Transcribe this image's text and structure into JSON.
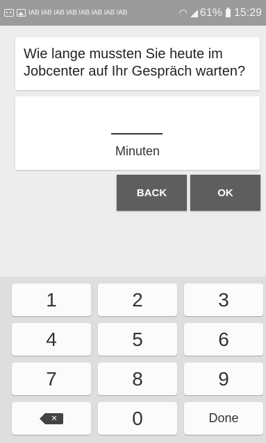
{
  "status_bar": {
    "notification_text": "IAB IAB IAB IAB IAB IAB IAB IAB",
    "battery": "61%",
    "time": "15:29"
  },
  "question": {
    "text": "Wie lange mussten Sie heute im Jobcenter auf Ihr Gespräch warten?"
  },
  "answer": {
    "value": "",
    "unit": "Minuten"
  },
  "buttons": {
    "back": "BACK",
    "ok": "OK"
  },
  "keyboard": {
    "keys": [
      "1",
      "2",
      "3",
      "4",
      "5",
      "6",
      "7",
      "8",
      "9"
    ],
    "zero": "0",
    "done": "Done",
    "backspace_icon": "backspace-icon"
  },
  "colors": {
    "status_bar": "#9b9b9b",
    "background": "#ededed",
    "button": "#5e5e5e",
    "keyboard": "#dedede"
  }
}
